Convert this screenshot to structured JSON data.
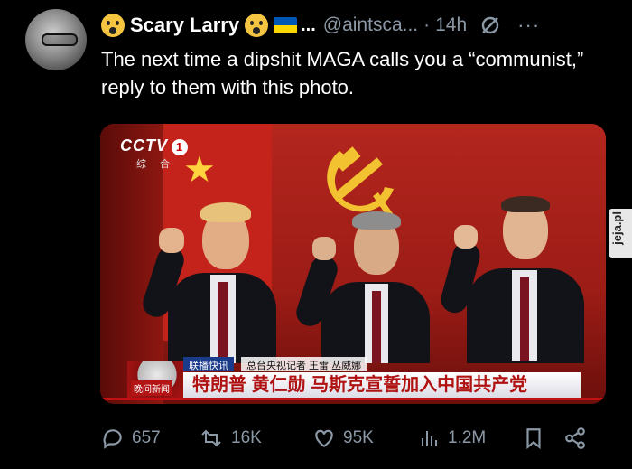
{
  "tweet": {
    "author_name": "Scary Larry",
    "handle": "@aintsca...",
    "separator": "·",
    "time": "14h",
    "more_label": "···",
    "text": "The next time a dipshit MAGA calls you a “communist,” reply to them with this photo."
  },
  "media": {
    "channel_logo": "CCTV",
    "channel_number": "1",
    "channel_sub": "综 合",
    "ticker_tag": "联播快讯",
    "ticker_reporter": "总台央视记者 王雷 丛威娜",
    "ticker_headline": "特朗普 黄仁勋 马斯克宣誓加入中国共产党",
    "ticker_logo_text": "晚间新闻",
    "watermark": "jeja.pl"
  },
  "actions": {
    "replies": "657",
    "retweets": "16K",
    "likes": "95K",
    "views": "1.2M"
  },
  "icons": [
    "scream-emoji-icon",
    "ukraine-flag-icon",
    "grok-icon",
    "more-icon",
    "reply-icon",
    "retweet-icon",
    "like-icon",
    "views-icon",
    "bookmark-icon",
    "share-icon"
  ],
  "colors": {
    "background": "#000000",
    "text": "#e7e9ea",
    "muted": "#8b98a5"
  }
}
